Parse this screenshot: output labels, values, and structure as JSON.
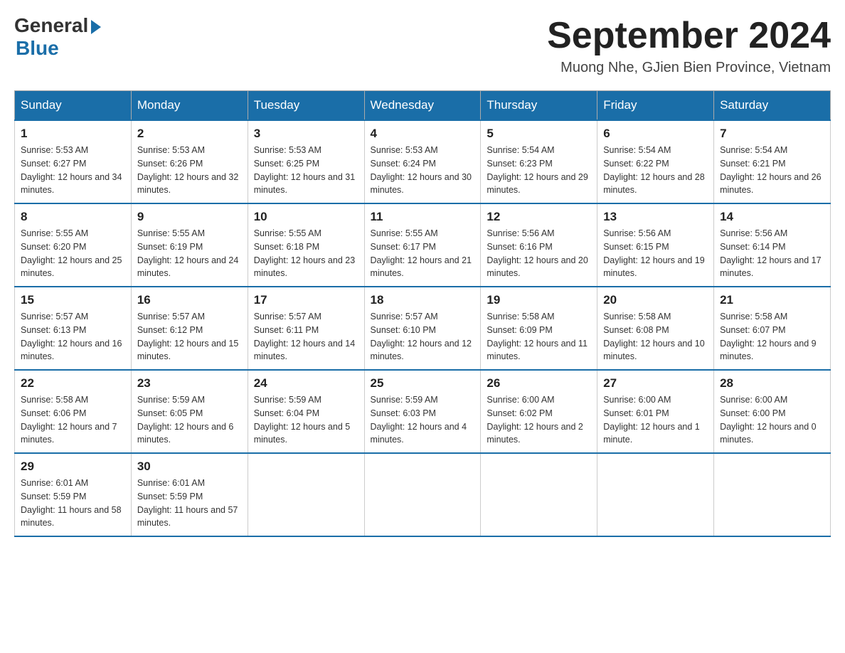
{
  "logo": {
    "general": "General",
    "blue": "Blue"
  },
  "title": {
    "month_year": "September 2024",
    "location": "Muong Nhe, GJien Bien Province, Vietnam"
  },
  "weekdays": [
    "Sunday",
    "Monday",
    "Tuesday",
    "Wednesday",
    "Thursday",
    "Friday",
    "Saturday"
  ],
  "weeks": [
    [
      {
        "day": "1",
        "sunrise": "5:53 AM",
        "sunset": "6:27 PM",
        "daylight": "12 hours and 34 minutes."
      },
      {
        "day": "2",
        "sunrise": "5:53 AM",
        "sunset": "6:26 PM",
        "daylight": "12 hours and 32 minutes."
      },
      {
        "day": "3",
        "sunrise": "5:53 AM",
        "sunset": "6:25 PM",
        "daylight": "12 hours and 31 minutes."
      },
      {
        "day": "4",
        "sunrise": "5:53 AM",
        "sunset": "6:24 PM",
        "daylight": "12 hours and 30 minutes."
      },
      {
        "day": "5",
        "sunrise": "5:54 AM",
        "sunset": "6:23 PM",
        "daylight": "12 hours and 29 minutes."
      },
      {
        "day": "6",
        "sunrise": "5:54 AM",
        "sunset": "6:22 PM",
        "daylight": "12 hours and 28 minutes."
      },
      {
        "day": "7",
        "sunrise": "5:54 AM",
        "sunset": "6:21 PM",
        "daylight": "12 hours and 26 minutes."
      }
    ],
    [
      {
        "day": "8",
        "sunrise": "5:55 AM",
        "sunset": "6:20 PM",
        "daylight": "12 hours and 25 minutes."
      },
      {
        "day": "9",
        "sunrise": "5:55 AM",
        "sunset": "6:19 PM",
        "daylight": "12 hours and 24 minutes."
      },
      {
        "day": "10",
        "sunrise": "5:55 AM",
        "sunset": "6:18 PM",
        "daylight": "12 hours and 23 minutes."
      },
      {
        "day": "11",
        "sunrise": "5:55 AM",
        "sunset": "6:17 PM",
        "daylight": "12 hours and 21 minutes."
      },
      {
        "day": "12",
        "sunrise": "5:56 AM",
        "sunset": "6:16 PM",
        "daylight": "12 hours and 20 minutes."
      },
      {
        "day": "13",
        "sunrise": "5:56 AM",
        "sunset": "6:15 PM",
        "daylight": "12 hours and 19 minutes."
      },
      {
        "day": "14",
        "sunrise": "5:56 AM",
        "sunset": "6:14 PM",
        "daylight": "12 hours and 17 minutes."
      }
    ],
    [
      {
        "day": "15",
        "sunrise": "5:57 AM",
        "sunset": "6:13 PM",
        "daylight": "12 hours and 16 minutes."
      },
      {
        "day": "16",
        "sunrise": "5:57 AM",
        "sunset": "6:12 PM",
        "daylight": "12 hours and 15 minutes."
      },
      {
        "day": "17",
        "sunrise": "5:57 AM",
        "sunset": "6:11 PM",
        "daylight": "12 hours and 14 minutes."
      },
      {
        "day": "18",
        "sunrise": "5:57 AM",
        "sunset": "6:10 PM",
        "daylight": "12 hours and 12 minutes."
      },
      {
        "day": "19",
        "sunrise": "5:58 AM",
        "sunset": "6:09 PM",
        "daylight": "12 hours and 11 minutes."
      },
      {
        "day": "20",
        "sunrise": "5:58 AM",
        "sunset": "6:08 PM",
        "daylight": "12 hours and 10 minutes."
      },
      {
        "day": "21",
        "sunrise": "5:58 AM",
        "sunset": "6:07 PM",
        "daylight": "12 hours and 9 minutes."
      }
    ],
    [
      {
        "day": "22",
        "sunrise": "5:58 AM",
        "sunset": "6:06 PM",
        "daylight": "12 hours and 7 minutes."
      },
      {
        "day": "23",
        "sunrise": "5:59 AM",
        "sunset": "6:05 PM",
        "daylight": "12 hours and 6 minutes."
      },
      {
        "day": "24",
        "sunrise": "5:59 AM",
        "sunset": "6:04 PM",
        "daylight": "12 hours and 5 minutes."
      },
      {
        "day": "25",
        "sunrise": "5:59 AM",
        "sunset": "6:03 PM",
        "daylight": "12 hours and 4 minutes."
      },
      {
        "day": "26",
        "sunrise": "6:00 AM",
        "sunset": "6:02 PM",
        "daylight": "12 hours and 2 minutes."
      },
      {
        "day": "27",
        "sunrise": "6:00 AM",
        "sunset": "6:01 PM",
        "daylight": "12 hours and 1 minute."
      },
      {
        "day": "28",
        "sunrise": "6:00 AM",
        "sunset": "6:00 PM",
        "daylight": "12 hours and 0 minutes."
      }
    ],
    [
      {
        "day": "29",
        "sunrise": "6:01 AM",
        "sunset": "5:59 PM",
        "daylight": "11 hours and 58 minutes."
      },
      {
        "day": "30",
        "sunrise": "6:01 AM",
        "sunset": "5:59 PM",
        "daylight": "11 hours and 57 minutes."
      },
      null,
      null,
      null,
      null,
      null
    ]
  ]
}
